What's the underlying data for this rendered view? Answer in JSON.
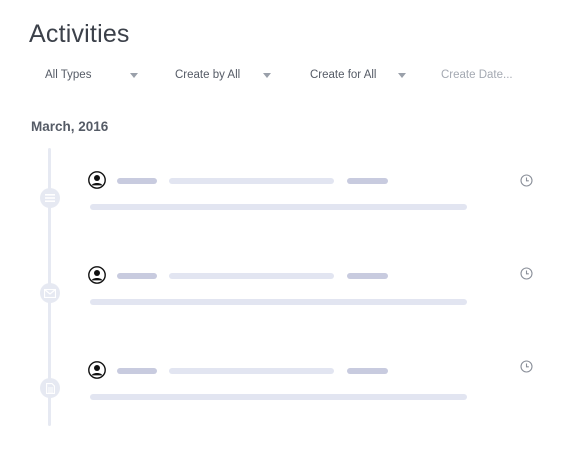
{
  "header": {
    "title": "Activities"
  },
  "filters": {
    "type": {
      "selected": "All Types"
    },
    "created_by": {
      "selected": "Create by All"
    },
    "created_for": {
      "selected": "Create for All"
    },
    "date": {
      "placeholder": "Create Date..."
    }
  },
  "timeline": {
    "month": "March, 2016",
    "items": [
      {
        "type_icon": "list-icon",
        "loading": true
      },
      {
        "type_icon": "envelope-icon",
        "loading": true
      },
      {
        "type_icon": "document-icon",
        "loading": true
      }
    ]
  },
  "colors": {
    "timeline": "#e6e9f2",
    "placeholder_dark": "#c8cbdf",
    "placeholder_light": "#e2e5f1",
    "text": "#3c414a"
  }
}
